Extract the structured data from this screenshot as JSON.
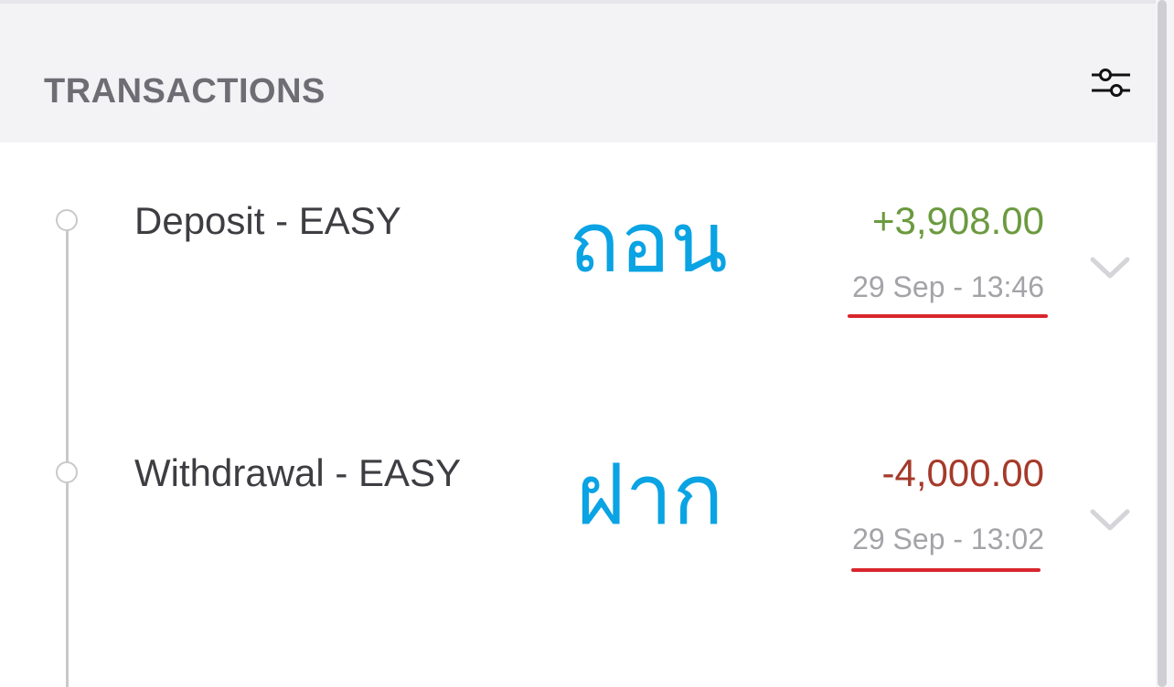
{
  "header": {
    "title": "TRANSACTIONS",
    "filter_icon": "sliders-icon"
  },
  "colors": {
    "positive": "#6b9a3f",
    "negative": "#a53a2a",
    "annotation": "#0aa3e3",
    "underline": "#d8262d"
  },
  "transactions": [
    {
      "title": "Deposit - EASY",
      "annotation": "ถอน",
      "amount": "+3,908.00",
      "time": "29 Sep - 13:46",
      "icon": "chevron-down-icon"
    },
    {
      "title": "Withdrawal - EASY",
      "annotation": "ฝาก",
      "amount": "-4,000.00",
      "time": "29 Sep - 13:02",
      "icon": "chevron-down-icon"
    }
  ]
}
